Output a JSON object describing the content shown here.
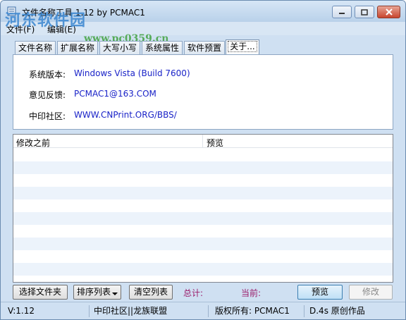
{
  "window": {
    "title": "文件名称工具 1.12  by PCMAC1"
  },
  "watermark": {
    "text": "河东软件园",
    "url": "www.pc0359.cn"
  },
  "menu": {
    "items": [
      "文件(F)",
      "编辑(E)"
    ]
  },
  "tabs": [
    {
      "label": "文件名称",
      "active": false
    },
    {
      "label": "扩展名称",
      "active": false
    },
    {
      "label": "大写小写",
      "active": false
    },
    {
      "label": "系统属性",
      "active": false
    },
    {
      "label": "软件预置",
      "active": false
    },
    {
      "label": "关于...",
      "active": true
    }
  ],
  "about": {
    "rows": [
      {
        "label": "系统版本:",
        "value": "Windows Vista (Build 7600)"
      },
      {
        "label": "意见反馈:",
        "value": "PCMAC1@163.COM"
      },
      {
        "label": "中印社区:",
        "value": "WWW.CNPrint.ORG/BBS/"
      }
    ]
  },
  "list": {
    "columns": [
      "修改之前",
      "预览"
    ],
    "rows": []
  },
  "toolbar": {
    "select_folder": "选择文件夹",
    "sort_list": "排序列表",
    "clear_list": "清空列表",
    "total_label": "总计:",
    "current_label": "当前:",
    "preview": "预览",
    "modify": "修改"
  },
  "statusbar": {
    "version": "V:1.12",
    "community": "中印社区||龙族联盟",
    "copyright": "版权所有: PCMAC1",
    "tagline": "D.4s 原创作品"
  },
  "colors": {
    "accent": "#1a23c8",
    "stat_label": "#9b1b6a",
    "stripe": "#ecf3fb"
  }
}
